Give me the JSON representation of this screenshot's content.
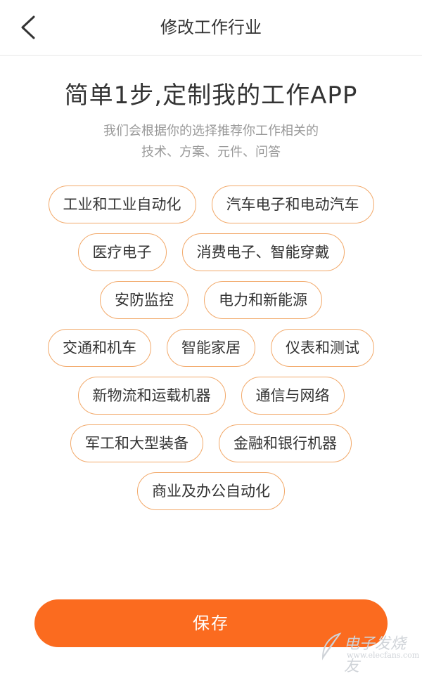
{
  "header": {
    "title": "修改工作行业",
    "back_icon": "chevron-left-icon"
  },
  "hero": {
    "title": "简单1步,定制我的工作APP",
    "subtitle_line1": "我们会根据你的选择推荐你工作相关的",
    "subtitle_line2": "技术、方案、元件、问答"
  },
  "industries": [
    [
      "工业和工业自动化",
      "汽车电子和电动汽车"
    ],
    [
      "医疗电子",
      "消费电子、智能穿戴"
    ],
    [
      "安防监控",
      "电力和新能源"
    ],
    [
      "交通和机车",
      "智能家居",
      "仪表和测试"
    ],
    [
      "新物流和运载机器",
      "通信与网络"
    ],
    [
      "军工和大型装备",
      "金融和银行机器"
    ],
    [
      "商业及办公自动化"
    ]
  ],
  "footer": {
    "save_label": "保存"
  },
  "watermark": {
    "text": "电子发烧友",
    "url": "www.elecfans.com"
  },
  "colors": {
    "accent": "#fb6b1f",
    "tag_border": "#f2a96a",
    "subtext": "#999999"
  }
}
